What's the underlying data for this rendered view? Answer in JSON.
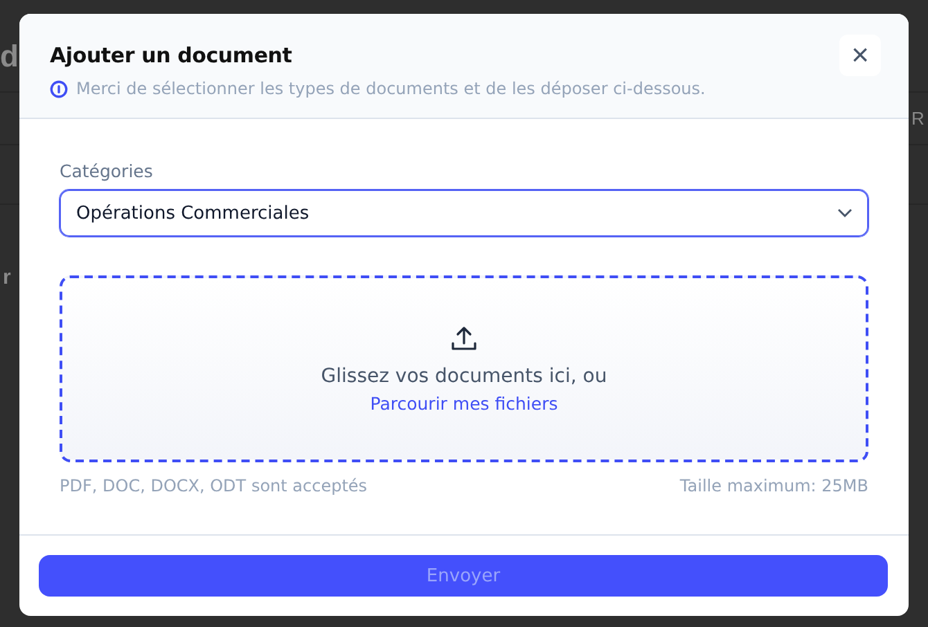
{
  "backdrop": {
    "texts": [
      {
        "kind": "heading",
        "text": "d"
      },
      {
        "kind": "column",
        "text": "R"
      },
      {
        "kind": "row",
        "text": "r"
      }
    ]
  },
  "dialog": {
    "title": "Ajouter un document",
    "info": "Merci de sélectionner les types de documents et de les déposer ci-dessous.",
    "close": "×",
    "category": {
      "label": "Catégories",
      "value": "Opérations Commerciales",
      "focused": true
    },
    "dropzone": {
      "prompt": "Glissez vos documents ici, ou",
      "browse": "Parcourir mes fichiers"
    },
    "formats": "PDF, DOC, DOCX, ODT sont acceptés",
    "max_size": "Taille maximum: 25MB",
    "submit": {
      "label": "Envoyer",
      "disabled": true
    }
  }
}
